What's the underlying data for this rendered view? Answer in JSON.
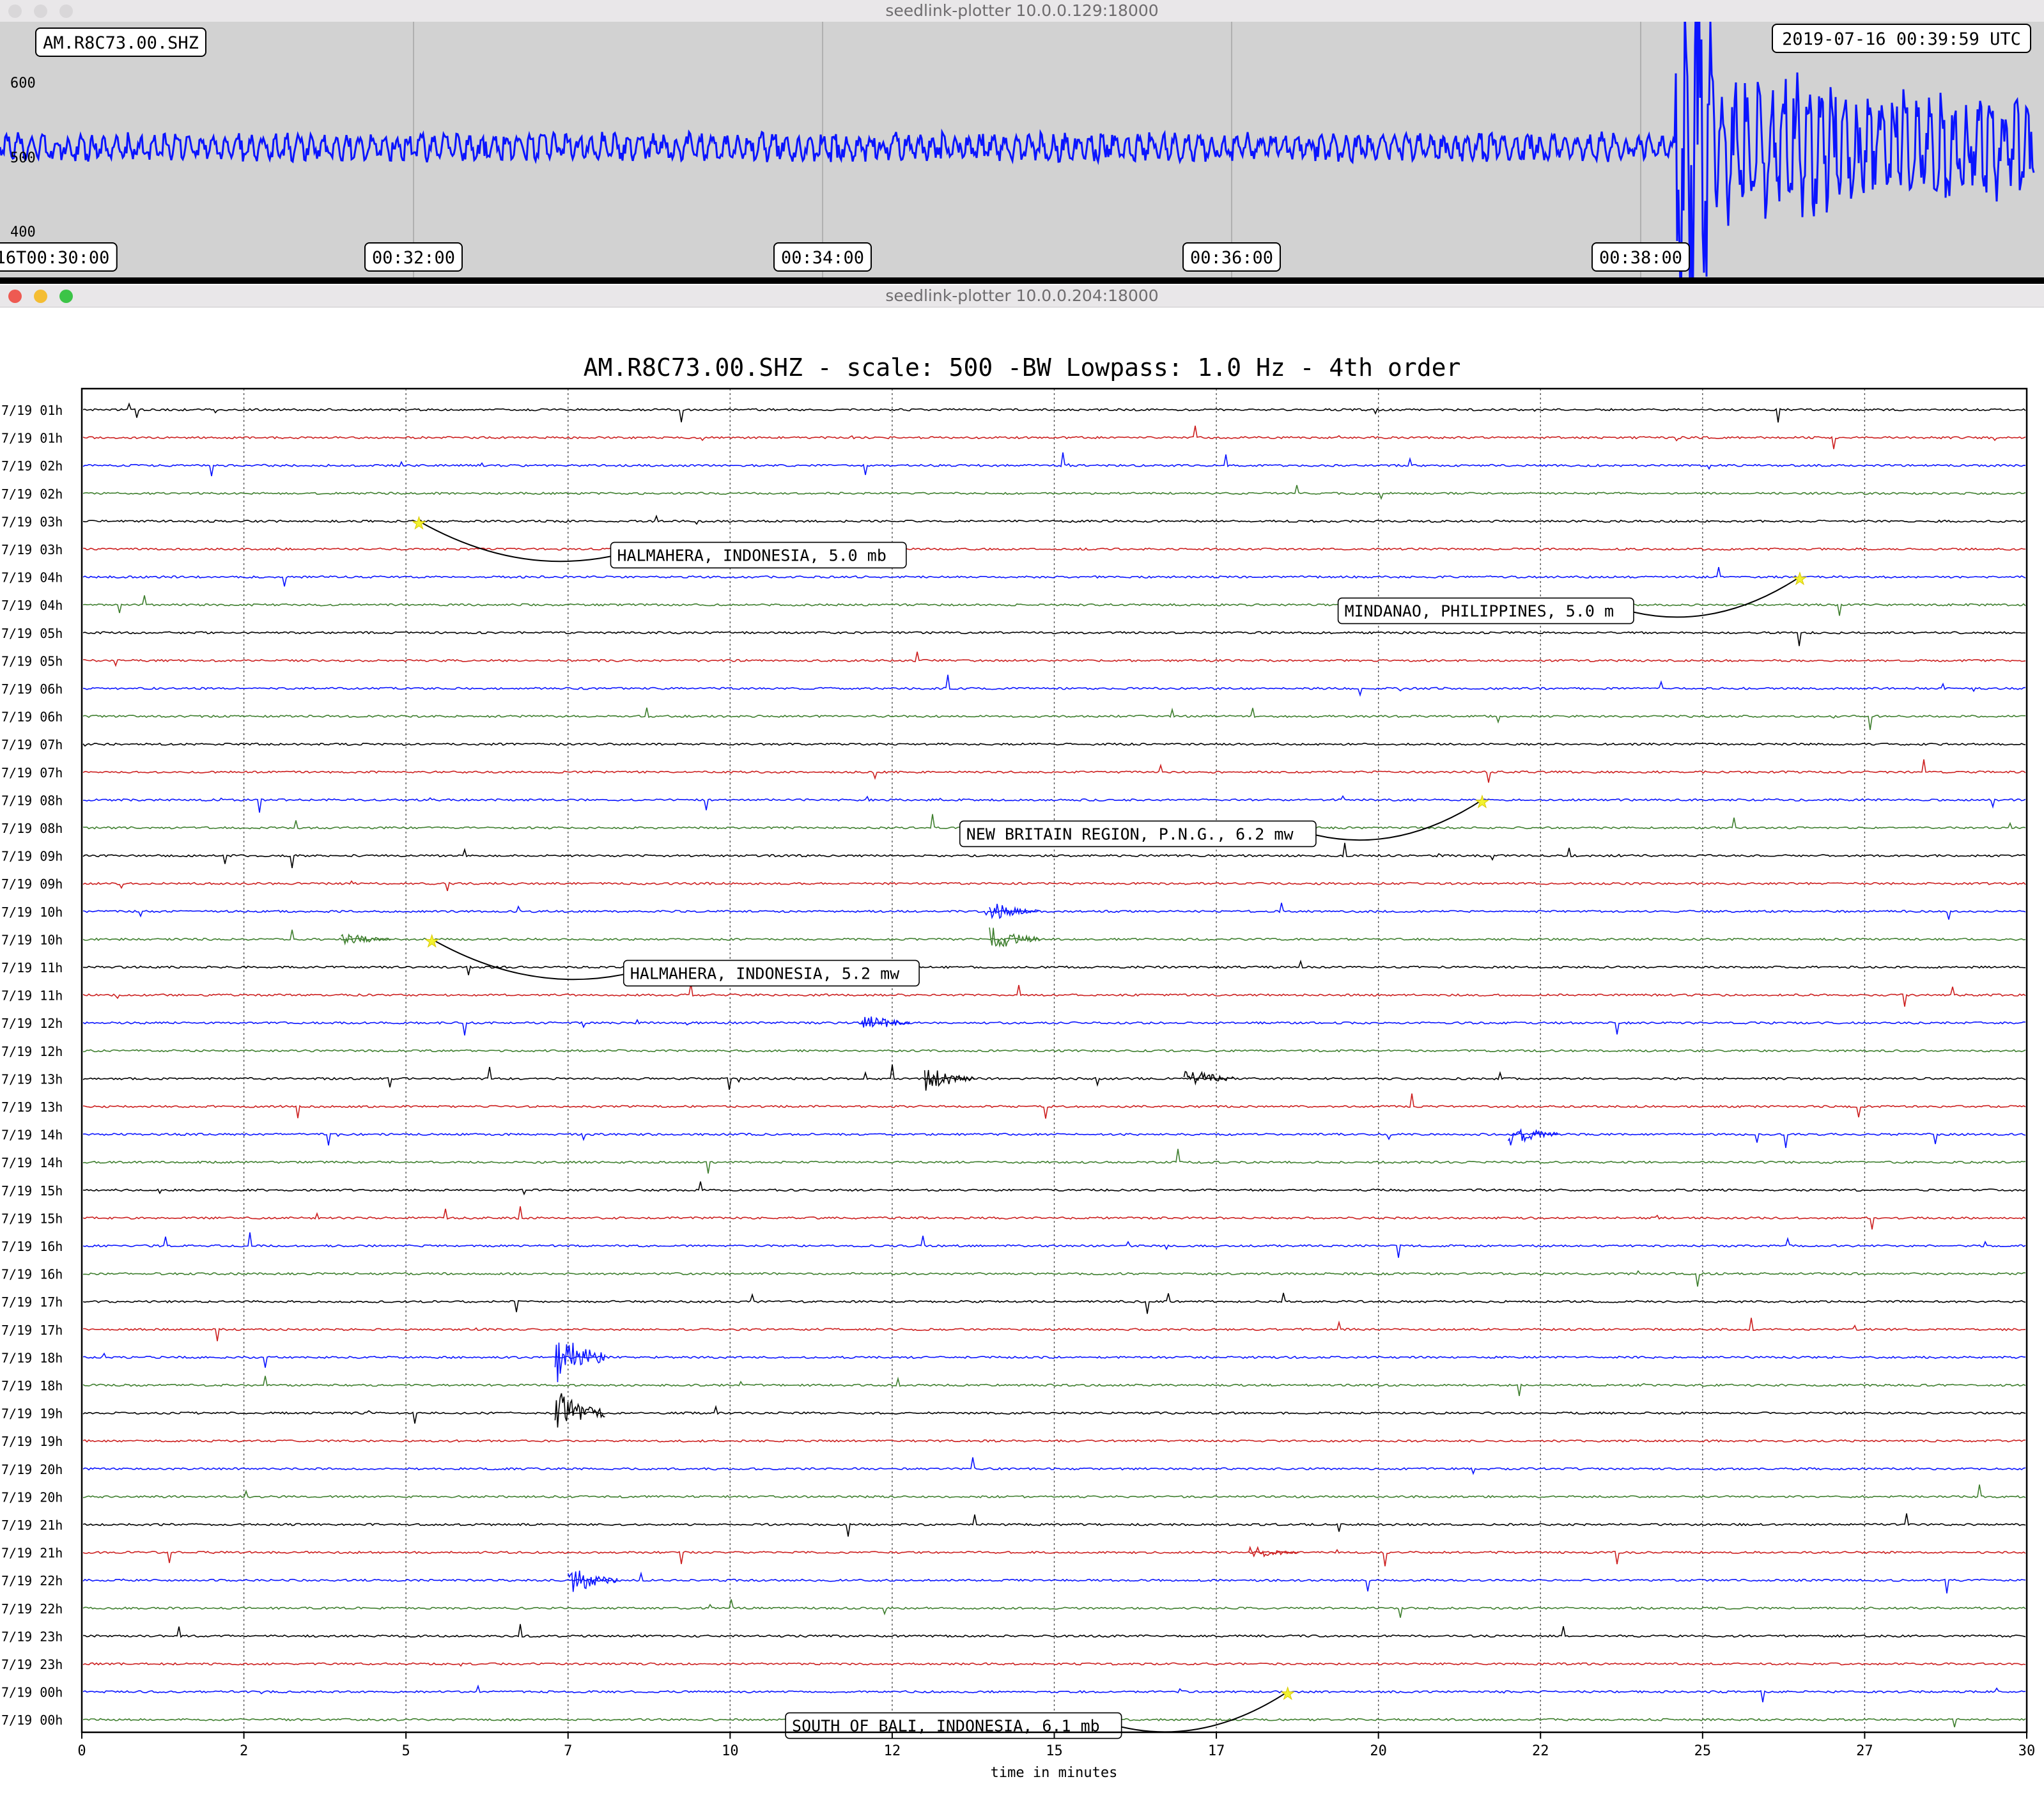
{
  "window_top": {
    "title": "seedlink-plotter 10.0.0.129:18000",
    "station_label": "AM.R8C73.00.SHZ",
    "timestamp_label": "2019-07-16 00:39:59 UTC",
    "y_ticks": [
      "600",
      "500",
      "400"
    ],
    "x_ticks": [
      "16T00:30:00",
      "00:32:00",
      "00:34:00",
      "00:36:00",
      "00:38:00"
    ],
    "trace_color": "#0a14ff"
  },
  "window_main": {
    "title": "seedlink-plotter 10.0.0.204:18000",
    "plot_title": "AM.R8C73.00.SHZ - scale: 500 -BW Lowpass: 1.0 Hz - 4th order",
    "x_label": "time in minutes",
    "x_ticks": [
      "0",
      "2",
      "5",
      "7",
      "10",
      "12",
      "15",
      "17",
      "20",
      "22",
      "25",
      "27",
      "30"
    ],
    "row_labels": [
      "7/19 01h",
      "7/19 01h",
      "7/19 02h",
      "7/19 02h",
      "7/19 03h",
      "7/19 03h",
      "7/19 04h",
      "7/19 04h",
      "7/19 05h",
      "7/19 05h",
      "7/19 06h",
      "7/19 06h",
      "7/19 07h",
      "7/19 07h",
      "7/19 08h",
      "7/19 08h",
      "7/19 09h",
      "7/19 09h",
      "7/19 10h",
      "7/19 10h",
      "7/19 11h",
      "7/19 11h",
      "7/19 12h",
      "7/19 12h",
      "7/19 13h",
      "7/19 13h",
      "7/19 14h",
      "7/19 14h",
      "7/19 15h",
      "7/19 15h",
      "7/19 16h",
      "7/19 16h",
      "7/19 17h",
      "7/19 17h",
      "7/19 18h",
      "7/19 18h",
      "7/19 19h",
      "7/19 19h",
      "7/19 20h",
      "7/19 20h",
      "7/19 21h",
      "7/19 21h",
      "7/19 22h",
      "7/19 22h",
      "7/19 23h",
      "7/19 23h",
      "7/19 00h",
      "7/19 00h"
    ],
    "row_colors": [
      "#000000",
      "#cc1f1f",
      "#0a14ff",
      "#3f7f2f"
    ],
    "events": [
      {
        "label": "HALMAHERA, INDONESIA, 5.0 mb",
        "row": 4,
        "minute": 5.2
      },
      {
        "label": "MINDANAO, PHILIPPINES, 5.0 m",
        "row": 6,
        "minute": 26.5
      },
      {
        "label": "NEW BRITAIN REGION, P.N.G., 6.2 mw",
        "row": 14,
        "minute": 21.6
      },
      {
        "label": "HALMAHERA, INDONESIA, 5.2 mw",
        "row": 19,
        "minute": 5.4
      },
      {
        "label": "SOUTH OF BALI, INDONESIA, 6.1 mb",
        "row": 46,
        "minute": 18.6
      }
    ]
  }
}
